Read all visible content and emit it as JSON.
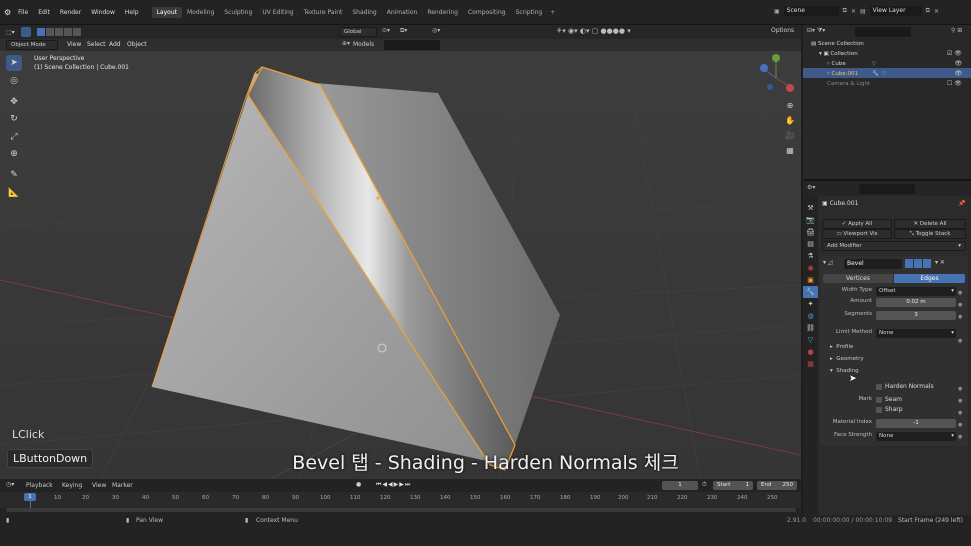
{
  "topbar": {
    "menus": [
      "File",
      "Edit",
      "Render",
      "Window",
      "Help"
    ],
    "workspaces": [
      "Layout",
      "Modeling",
      "Sculpting",
      "UV Editing",
      "Texture Paint",
      "Shading",
      "Animation",
      "Rendering",
      "Compositing",
      "Scripting"
    ],
    "active_workspace": "Layout",
    "scene": "Scene",
    "view_layer": "View Layer"
  },
  "viewport_header": {
    "mode": "Object Mode",
    "menus": [
      "View",
      "Select",
      "Add",
      "Object"
    ],
    "orientation": "Global",
    "snap_label": "Models",
    "options": "Options"
  },
  "viewport": {
    "perspective": "User Perspective",
    "collection_info": "(1) Scene Collection | Cube.001"
  },
  "overlay": {
    "click_label": "LClick",
    "button_label": "LButtonDown",
    "subtitle": "Bevel 탭 - Shading - Harden Normals 체크"
  },
  "outliner": {
    "items": [
      {
        "label": "Scene Collection"
      },
      {
        "label": "Collection"
      },
      {
        "label": "Cube"
      },
      {
        "label": "Cube.001"
      },
      {
        "label": "Camera & Light"
      }
    ]
  },
  "properties": {
    "object_name": "Cube.001",
    "apply_all": "Apply All",
    "delete_all": "Delete All",
    "viewport_vis": "Viewport Vis",
    "toggle_stack": "Toggle Stack",
    "add_modifier": "Add Modifier",
    "modifier_name": "Bevel",
    "tab_vertices": "Vertices",
    "tab_edges": "Edges",
    "width_type_label": "Width Type",
    "width_type_value": "Offset",
    "amount_label": "Amount",
    "amount_value": "0.02 m",
    "segments_label": "Segments",
    "segments_value": "3",
    "limit_method_label": "Limit Method",
    "limit_method_value": "None",
    "profile": "Profile",
    "geometry": "Geometry",
    "shading": "Shading",
    "harden_normals": "Harden Normals",
    "mark_label": "Mark",
    "seam": "Seam",
    "sharp": "Sharp",
    "material_index_label": "Material Index",
    "material_index_value": "-1",
    "face_strength_label": "Face Strength",
    "face_strength_value": "None"
  },
  "timeline": {
    "menus": [
      "Playback",
      "Keying",
      "View",
      "Marker"
    ],
    "current_frame": "1",
    "start_label": "Start",
    "start_value": "1",
    "end_label": "End",
    "end_value": "250",
    "ticks": [
      "1",
      "10",
      "20",
      "30",
      "40",
      "50",
      "60",
      "70",
      "80",
      "90",
      "100",
      "110",
      "120",
      "130",
      "140",
      "150",
      "160",
      "170",
      "180",
      "190",
      "200",
      "210",
      "220",
      "230",
      "240",
      "250"
    ]
  },
  "statusbar": {
    "pan_view": "Pan View",
    "context_menu": "Context Menu",
    "version": "2.91.0",
    "timecode": "00:00:00:00 / 00:00:10:09",
    "start_frame": "Start Frame (249 left)"
  },
  "colors": {
    "accent": "#4772b3",
    "selection_orange": "#f0a030",
    "axis_red": "#a03c3c"
  }
}
